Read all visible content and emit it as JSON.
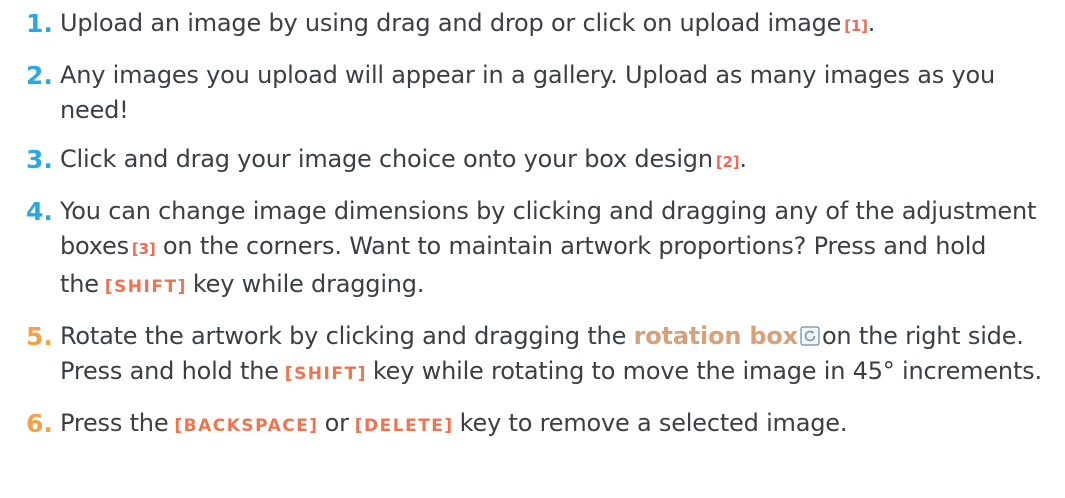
{
  "steps": [
    {
      "number": "1.",
      "number_color": "#29a9e1",
      "text_a": "Upload an image by using drag and drop or click on upload image",
      "ref": "[1]",
      "text_b": "."
    },
    {
      "number": "2.",
      "number_color": "#29a9e1",
      "text_a": "Any images you upload will appear in a gallery. Upload as many images as you need!"
    },
    {
      "number": "3.",
      "number_color": "#29a9e1",
      "text_a": "Click and drag your image choice onto your box design",
      "ref": "[2]",
      "text_b": "."
    },
    {
      "number": "4.",
      "number_color": "#29a9e1",
      "text_a": "You can change image dimensions by clicking and dragging any of the adjustment boxes",
      "ref": "[3]",
      "text_b": "on the corners. Want to maintain artwork proportions? Press and hold the",
      "key": "[SHIFT]",
      "text_c": "key while dragging."
    },
    {
      "number": "5.",
      "number_color": "#f0a14a",
      "text_a": "Rotate the artwork by clicking and dragging the",
      "highlight": "rotation box",
      "icon": "rotate-icon",
      "text_b": "on the right side. Press and hold the",
      "key": "[SHIFT]",
      "text_c": "key while rotating to move the image in 45° increments."
    },
    {
      "number": "6.",
      "number_color": "#f0a14a",
      "text_a": "Press the",
      "key1": "[BACKSPACE]",
      "text_b": "or",
      "key2": "[DELETE]",
      "text_c": "key to remove a selected image."
    }
  ],
  "colors": {
    "ref": "#f06a55",
    "key": "#f0734f",
    "highlight": "#d9a07a",
    "body_text": "#3b3f45"
  }
}
